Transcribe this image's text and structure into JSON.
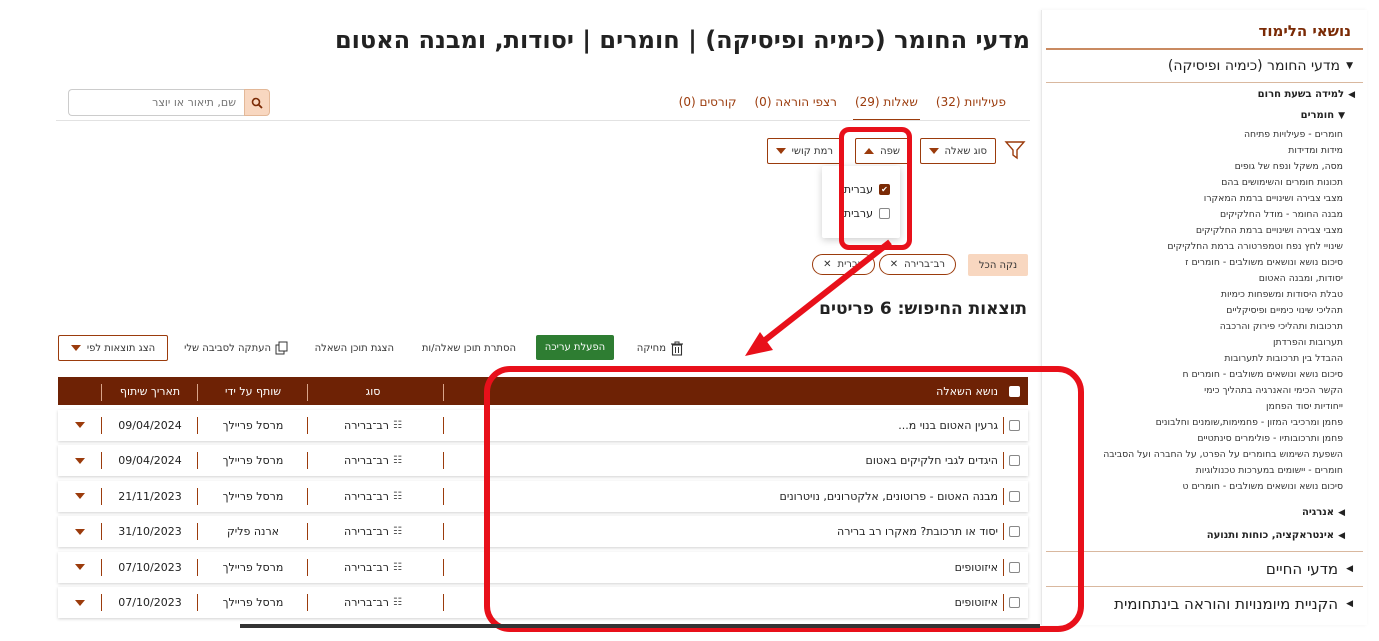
{
  "sidebar": {
    "title": "נושאי הלימוד",
    "main_topic": "מדעי החומר (כימיה ופיסיקה)",
    "sub1": "למידה בשעת חרום",
    "sub2": "חומרים",
    "leaves": [
      "חומרים - פעילויות פתיחה",
      "מידות ומדידות",
      "מסה, משקל ונפח של גופים",
      "תכונות חומרים והשימושים בהם",
      "מצבי צבירה ושינויים ברמת המאקרו",
      "מבנה החומר - מודל החלקיקים",
      "מצבי צבירה ושינויים ברמת החלקיקים",
      "שינויי לחץ נפח וטמפרטורה ברמת החלקיקים",
      "סיכום נושא ונושאים משולבים - חומרים ז",
      "יסודות, ומבנה האטום",
      "טבלת היסודות ומשפחות כימיות",
      "תהליכי שינוי כימיים ופיסיקליים",
      "תרכובות ותהליכי פירוק והרכבה",
      "תערובות והפרדתן",
      "ההבדל בין תרכובות לתערובות",
      "סיכום נושא ונושאים משולבים - חומרים ח",
      "הקשר הכימי והאנרגיה בתהליך כימי",
      "ייחודיות יסוד הפחמן",
      "פחמן ומרכיבי המזון - פחמימות,שומנים וחלבונים",
      "פחמן ותרכובותיו - פולימרים סינתטיים",
      "השפעת השימוש בחומרים על הפרט, על החברה ועל הסביבה",
      "חומרים - יישומים במערכות טכנולוגיות",
      "סיכום נושא ונושאים משולבים - חומרים ט"
    ],
    "sub3": "אנרגיה",
    "sub4": "אינטראקציה, כוחות ותנועה",
    "section2": "מדעי החיים",
    "section3": "הקניית מיומנויות והוראה בינתחומית"
  },
  "page_title": "מדעי החומר (כימיה ופיסיקה) | חומרים | יסודות, ומבנה האטום",
  "tabs": [
    {
      "label": "פעילויות (32)"
    },
    {
      "label": "שאלות (29)"
    },
    {
      "label": "רצפי הוראה (0)"
    },
    {
      "label": "קורסים (0)"
    }
  ],
  "search": {
    "placeholder": "שם, תיאור או יוצר"
  },
  "filters": {
    "question_type": "סוג שאלה",
    "language": "שפה",
    "difficulty": "רמת קושי",
    "language_options": [
      {
        "label": "עברית",
        "checked": true
      },
      {
        "label": "ערבית",
        "checked": false
      }
    ]
  },
  "chips": [
    {
      "label": "רב־ברירה"
    },
    {
      "label": "עברית"
    }
  ],
  "clear_all": "נקה הכל",
  "results_title": "תוצאות החיפוש: 6 פריטים",
  "toolbar": {
    "delete": "מחיקה",
    "enable_edit": "הפעלת עריכה",
    "hide_content": "הסתרת תוכן שאלה/ות",
    "show_content": "הצגת תוכן השאלה",
    "copy": "העתקה לסביבה שלי",
    "show_by": "הצג תוצאות לפי"
  },
  "table": {
    "headers": {
      "subject": "נושא השאלה",
      "type": "סוג",
      "shared_by": "שותף על ידי",
      "date": "תאריך שיתוף"
    },
    "rows": [
      {
        "subject": "גרעין האטום בנוי מ...",
        "type": "רב־ברירה",
        "shared_by": "מרסל פריילך",
        "date": "09/04/2024"
      },
      {
        "subject": "היגדים לגבי חלקיקים באטום",
        "type": "רב־ברירה",
        "shared_by": "מרסל פריילך",
        "date": "09/04/2024"
      },
      {
        "subject": "מבנה האטום - פרוטונים, אלקטרונים, נויטרונים",
        "type": "רב־ברירה",
        "shared_by": "מרסל פריילך",
        "date": "21/11/2023"
      },
      {
        "subject": "יסוד או תרכובת? מאקרו רב ברירה",
        "type": "רב־ברירה",
        "shared_by": "ארנה פליק",
        "date": "31/10/2023"
      },
      {
        "subject": "איזוטופים",
        "type": "רב־ברירה",
        "shared_by": "מרסל פריילך",
        "date": "07/10/2023"
      },
      {
        "subject": "איזוטופים",
        "type": "רב־ברירה",
        "shared_by": "מרסל פריילך",
        "date": "07/10/2023"
      }
    ]
  },
  "colors": {
    "brand": "#9b3b0c",
    "header_bg": "#6e2205",
    "annotation": "#e8101a",
    "edit_button": "#2e7d32"
  }
}
